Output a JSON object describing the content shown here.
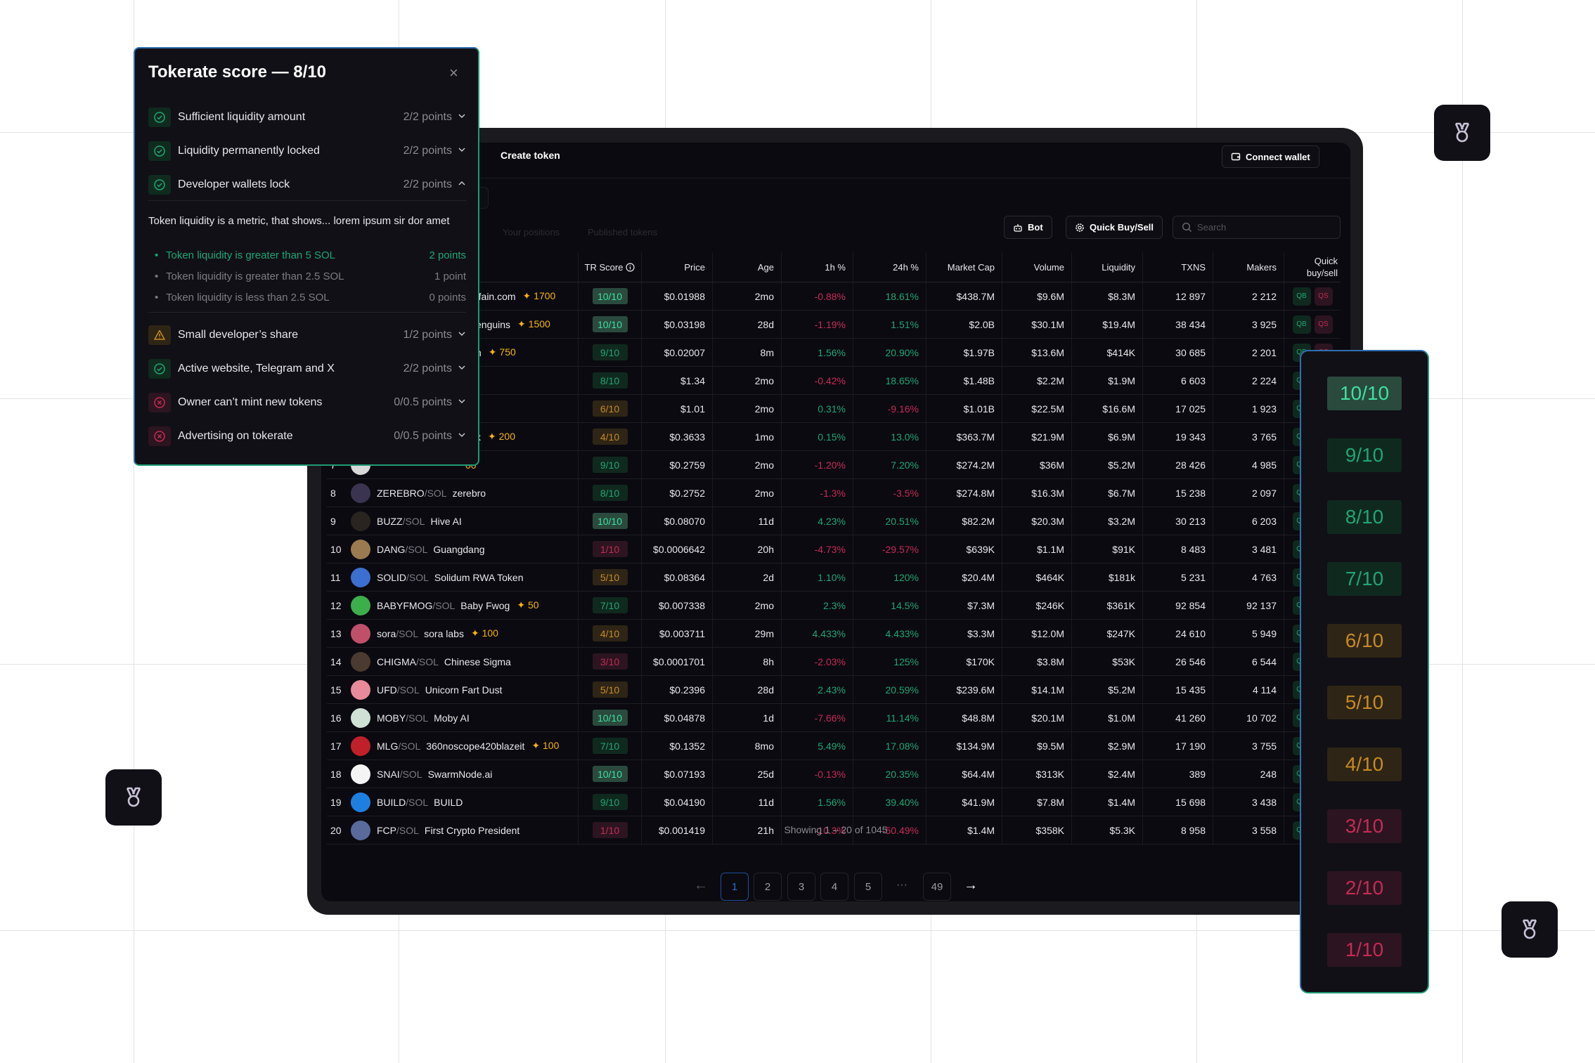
{
  "colors": {
    "accent": "#1f9a74",
    "green_bright": "#3fe0a0",
    "green": "#1ea672",
    "amber": "#c88a25",
    "red": "#c52a55",
    "boost": "#f5b312",
    "page_active": "#1f6fe0"
  },
  "header": {
    "create_token": "Create token",
    "connect_wallet": "Connect wallet",
    "partial_button": "n"
  },
  "tabs": [
    "Your positions",
    "Published tokens"
  ],
  "toolbar": {
    "bot": "Bot",
    "quick_buy_sell": "Quick Buy/Sell",
    "search_placeholder": "Search"
  },
  "columns": [
    "TR Score",
    "Price",
    "Age",
    "1h %",
    "24h %",
    "Market Cap",
    "Volume",
    "Liquidity",
    "TXNS",
    "Makers",
    "Quick buy/sell"
  ],
  "quick": {
    "buy": "QB",
    "sell": "QS"
  },
  "rows": [
    {
      "n": "1",
      "ticker": "",
      "quote": "",
      "name": "ffain.com",
      "boost": "1700",
      "score": 10,
      "price": "$0.01988",
      "age": "2mo",
      "h1": "-0.88%",
      "h24": "18.61%",
      "mcap": "$438.7M",
      "vol": "$9.6M",
      "liq": "$8.3M",
      "txns": "12 897",
      "makers": "2 212",
      "avatar_color": "#777"
    },
    {
      "n": "2",
      "ticker": "",
      "quote": "",
      "name": "enguins",
      "boost": "1500",
      "score": 10,
      "price": "$0.03198",
      "age": "28d",
      "h1": "-1.19%",
      "h24": "1.51%",
      "mcap": "$2.0B",
      "vol": "$30.1M",
      "liq": "$19.4M",
      "txns": "38 434",
      "makers": "3 925",
      "avatar_color": "#777"
    },
    {
      "n": "3",
      "ticker": "",
      "quote": "",
      "name": "n",
      "boost": "750",
      "score": 9,
      "price": "$0.02007",
      "age": "8m",
      "h1": "1.56%",
      "h24": "20.90%",
      "mcap": "$1.97B",
      "vol": "$13.6M",
      "liq": "$414K",
      "txns": "30 685",
      "makers": "2 201",
      "avatar_color": "#777"
    },
    {
      "n": "4",
      "ticker": "",
      "quote": "",
      "name": "",
      "boost": "",
      "score": 8,
      "price": "$1.34",
      "age": "2mo",
      "h1": "-0.42%",
      "h24": "18.65%",
      "mcap": "$1.48B",
      "vol": "$2.2M",
      "liq": "$1.9M",
      "txns": "6 603",
      "makers": "2 224",
      "avatar_color": "#777"
    },
    {
      "n": "5",
      "ticker": "",
      "quote": "",
      "name": "",
      "boost": "",
      "score": 6,
      "price": "$1.01",
      "age": "2mo",
      "h1": "0.31%",
      "h24": "-9.16%",
      "mcap": "$1.01B",
      "vol": "$22.5M",
      "liq": "$16.6M",
      "txns": "17 025",
      "makers": "1 923",
      "avatar_color": "#777"
    },
    {
      "n": "6",
      "ticker": "",
      "quote": "",
      "name": "x",
      "boost": "200",
      "score": 4,
      "price": "$0.3633",
      "age": "1mo",
      "h1": "0.15%",
      "h24": "13.0%",
      "mcap": "$363.7M",
      "vol": "$21.9M",
      "liq": "$6.9M",
      "txns": "19 343",
      "makers": "3 765",
      "avatar_color": "#777"
    },
    {
      "n": "7",
      "ticker": "",
      "quote": "",
      "name": "",
      "boost": "00",
      "score": 9,
      "price": "$0.2759",
      "age": "2mo",
      "h1": "-1.20%",
      "h24": "7.20%",
      "mcap": "$274.2M",
      "vol": "$36M",
      "liq": "$5.2M",
      "txns": "28 426",
      "makers": "4 985",
      "avatar_color": "#d8d8d8"
    },
    {
      "n": "8",
      "ticker": "ZEREBRO",
      "quote": "/SOL",
      "name": "zerebro",
      "boost": "",
      "score": 8,
      "price": "$0.2752",
      "age": "2mo",
      "h1": "-1.3%",
      "h24": "-3.5%",
      "mcap": "$274.8M",
      "vol": "$16.3M",
      "liq": "$6.7M",
      "txns": "15 238",
      "makers": "2 097",
      "avatar_color": "#3a3450"
    },
    {
      "n": "9",
      "ticker": "BUZZ",
      "quote": "/SOL",
      "name": "Hive AI",
      "boost": "",
      "score": 10,
      "price": "$0.08070",
      "age": "11d",
      "h1": "4.23%",
      "h24": "20.51%",
      "mcap": "$82.2M",
      "vol": "$20.3M",
      "liq": "$3.2M",
      "txns": "30 213",
      "makers": "6 203",
      "avatar_color": "#2a2420"
    },
    {
      "n": "10",
      "ticker": "DANG",
      "quote": "/SOL",
      "name": "Guangdang",
      "boost": "",
      "score": 1,
      "price": "$0.0006642",
      "age": "20h",
      "h1": "-4.73%",
      "h24": "-29.57%",
      "mcap": "$639K",
      "vol": "$1.1M",
      "liq": "$91K",
      "txns": "8 483",
      "makers": "3 481",
      "avatar_color": "#9a7a50"
    },
    {
      "n": "11",
      "ticker": "SOLID",
      "quote": "/SOL",
      "name": "Solidum RWA Token",
      "boost": "",
      "score": 5,
      "price": "$0.08364",
      "age": "2d",
      "h1": "1.10%",
      "h24": "120%",
      "mcap": "$20.4M",
      "vol": "$464K",
      "liq": "$181k",
      "txns": "5 231",
      "makers": "4 763",
      "avatar_color": "#3b6fd0"
    },
    {
      "n": "12",
      "ticker": "BABYFMOG",
      "quote": "/SOL",
      "name": "Baby Fwog",
      "boost": "50",
      "score": 7,
      "price": "$0.007338",
      "age": "2mo",
      "h1": "2.3%",
      "h24": "14.5%",
      "mcap": "$7.3M",
      "vol": "$246K",
      "liq": "$361K",
      "txns": "92 854",
      "makers": "92 137",
      "avatar_color": "#3cae4a"
    },
    {
      "n": "13",
      "ticker": "sora",
      "quote": "/SOL",
      "name": "sora labs",
      "boost": "100",
      "score": 4,
      "price": "$0.003711",
      "age": "29m",
      "h1": "4.433%",
      "h24": "4.433%",
      "mcap": "$3.3M",
      "vol": "$12.0M",
      "liq": "$247K",
      "txns": "24 610",
      "makers": "5 949",
      "avatar_color": "#c0506a"
    },
    {
      "n": "14",
      "ticker": "CHIGMA",
      "quote": "/SOL",
      "name": "Chinese Sigma",
      "boost": "",
      "score": 3,
      "price": "$0.0001701",
      "age": "8h",
      "h1": "-2.03%",
      "h24": "125%",
      "mcap": "$170K",
      "vol": "$3.8M",
      "liq": "$53K",
      "txns": "26 546",
      "makers": "6 544",
      "avatar_color": "#4a3a30"
    },
    {
      "n": "15",
      "ticker": "UFD",
      "quote": "/SOL",
      "name": "Unicorn Fart Dust",
      "boost": "",
      "score": 5,
      "price": "$0.2396",
      "age": "28d",
      "h1": "2.43%",
      "h24": "20.59%",
      "mcap": "$239.6M",
      "vol": "$14.1M",
      "liq": "$5.2M",
      "txns": "15 435",
      "makers": "4 114",
      "avatar_color": "#e88a9a"
    },
    {
      "n": "16",
      "ticker": "MOBY",
      "quote": "/SOL",
      "name": "Moby AI",
      "boost": "",
      "score": 10,
      "price": "$0.04878",
      "age": "1d",
      "h1": "-7.66%",
      "h24": "11.14%",
      "mcap": "$48.8M",
      "vol": "$20.1M",
      "liq": "$1.0M",
      "txns": "41 260",
      "makers": "10 702",
      "avatar_color": "#cfe0d4"
    },
    {
      "n": "17",
      "ticker": "MLG",
      "quote": "/SOL",
      "name": "360noscope420blazeit",
      "boost": "100",
      "score": 7,
      "price": "$0.1352",
      "age": "8mo",
      "h1": "5.49%",
      "h24": "17.08%",
      "mcap": "$134.9M",
      "vol": "$9.5M",
      "liq": "$2.9M",
      "txns": "17 190",
      "makers": "3 755",
      "avatar_color": "#c0202a"
    },
    {
      "n": "18",
      "ticker": "SNAI",
      "quote": "/SOL",
      "name": "SwarmNode.ai",
      "boost": "",
      "score": 10,
      "price": "$0.07193",
      "age": "25d",
      "h1": "-0.13%",
      "h24": "20.35%",
      "mcap": "$64.4M",
      "vol": "$313K",
      "liq": "$2.4M",
      "txns": "389",
      "makers": "248",
      "avatar_color": "#f4f4f4"
    },
    {
      "n": "19",
      "ticker": "BUILD",
      "quote": "/SOL",
      "name": "BUILD",
      "boost": "",
      "score": 9,
      "price": "$0.04190",
      "age": "11d",
      "h1": "1.56%",
      "h24": "39.40%",
      "mcap": "$41.9M",
      "vol": "$7.8M",
      "liq": "$1.4M",
      "txns": "15 698",
      "makers": "3 438",
      "avatar_color": "#1e7fe0"
    },
    {
      "n": "20",
      "ticker": "FCP",
      "quote": "/SOL",
      "name": "First Crypto President",
      "boost": "",
      "score": 1,
      "price": "$0.001419",
      "age": "21h",
      "h1": "-10.3%",
      "h24": "-50.49%",
      "mcap": "$1.4M",
      "vol": "$358K",
      "liq": "$5.3K",
      "txns": "8 958",
      "makers": "3 558",
      "avatar_color": "#5a6a9a"
    }
  ],
  "pagination": {
    "showing": "Showing 1 – 20 of 1045",
    "pages": [
      "1",
      "2",
      "3",
      "4",
      "5"
    ],
    "ellipsis": "···",
    "last": "49",
    "active": "1"
  },
  "popup": {
    "title": "Tokerate score — 8/10",
    "items": [
      {
        "status": "ok",
        "label": "Sufficient liquidity amount",
        "points": "2/2 points",
        "open": false
      },
      {
        "status": "ok",
        "label": "Liquidity permanently locked",
        "points": "2/2 points",
        "open": false
      },
      {
        "status": "ok",
        "label": "Developer wallets lock",
        "points": "2/2 points",
        "open": true
      },
      {
        "status": "warn",
        "label": "Small developer’s share",
        "points": "1/2 points",
        "open": false
      },
      {
        "status": "ok",
        "label": "Active website, Telegram and X",
        "points": "2/2 points",
        "open": false
      },
      {
        "status": "fail",
        "label": "Owner can’t mint new tokens",
        "points": "0/0.5 points",
        "open": false
      },
      {
        "status": "fail",
        "label": "Advertising on tokerate",
        "points": "0/0.5 points",
        "open": false
      }
    ],
    "description": "Token liquidity is a metric, that shows... lorem ipsum sir dor amet",
    "criteria": [
      {
        "text": "Token liquidity is greater than 5 SOL",
        "points": "2 points",
        "active": true
      },
      {
        "text": "Token liquidity is greater than 2.5 SOL",
        "points": "1 point",
        "active": false
      },
      {
        "text": "Token liquidity is less than 2.5 SOL",
        "points": "0 points",
        "active": false
      }
    ]
  },
  "score_scale": [
    "10/10",
    "9/10",
    "8/10",
    "7/10",
    "6/10",
    "5/10",
    "4/10",
    "3/10",
    "2/10",
    "1/10"
  ],
  "icons": {
    "medal": "medal-icon",
    "wallet": "wallet-icon",
    "bot": "bot-icon",
    "gear": "gear-icon",
    "search": "search-icon",
    "boost": "sparkle-icon",
    "info": "info-icon"
  }
}
